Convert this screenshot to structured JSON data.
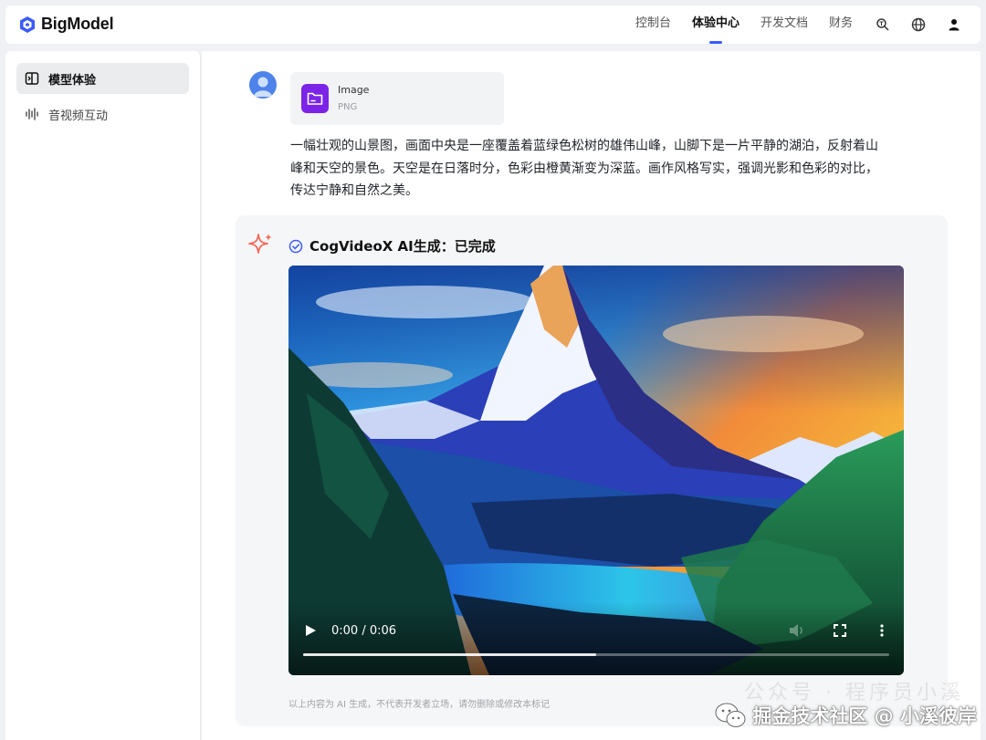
{
  "header": {
    "brand": "BigModel",
    "nav": [
      {
        "label": "控制台",
        "active": false
      },
      {
        "label": "体验中心",
        "active": true
      },
      {
        "label": "开发文档",
        "active": false
      },
      {
        "label": "财务",
        "active": false
      }
    ],
    "icons": [
      "search-translate-icon",
      "globe-icon",
      "user-icon"
    ]
  },
  "sidebar": {
    "items": [
      {
        "label": "模型体验",
        "icon": "model-panel-icon",
        "active": true
      },
      {
        "label": "音视频互动",
        "icon": "audio-wave-icon",
        "active": false
      }
    ]
  },
  "message": {
    "attachment": {
      "name": "Image",
      "type": "PNG",
      "icon": "image-file-icon"
    },
    "prompt": "一幅壮观的山景图，画面中央是一座覆盖着蓝绿色松树的雄伟山峰，山脚下是一片平静的湖泊，反射着山峰和天空的景色。天空是在日落时分，色彩由橙黄渐变为深蓝。画作风格写实，强调光影和色彩的对比，传达宁静和自然之美。"
  },
  "result": {
    "status": "CogVideoX AI生成：已完成",
    "video": {
      "time": "0:00 / 0:06",
      "progress": 0.5
    },
    "disclaimer": "以上内容为 AI 生成，不代表开发者立场，请勿删除或修改本标记"
  },
  "watermark": {
    "text": "掘金技术社区 @ 小溪彼岸",
    "faint": "公众号 · 程序员小溪"
  },
  "colors": {
    "accent": "#3b5bfd",
    "file_icon": "#7b24e8",
    "avatar": "#4d83ea",
    "sparkle": "#f26a5b"
  }
}
